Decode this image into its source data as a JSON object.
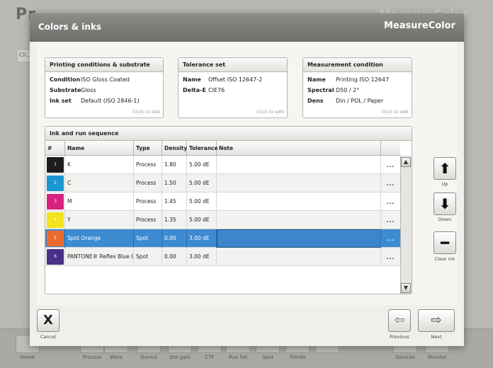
{
  "background": {
    "title": "Pr...",
    "brand": "MeasureColor",
    "sub_label": "Cli...",
    "bottom_tabs": [
      "Home",
      "Process",
      "Worx",
      "Gamut",
      "Dot gain",
      "CTF",
      "Run list",
      "Spot",
      "Trends",
      "",
      "Devices",
      "Monitor"
    ]
  },
  "modal": {
    "title": "Colors & inks",
    "brand": "MeasureColor"
  },
  "printing_conditions": {
    "header": "Printing conditions & substrate",
    "rows": [
      {
        "key": "Condition",
        "value": "ISO Gloss Coated"
      },
      {
        "key": "Substrate",
        "value": "Gloss"
      },
      {
        "key": "Ink set",
        "value": "Default  (ISO 2846-1)"
      }
    ],
    "hint": "Click to edit"
  },
  "tolerance_set": {
    "header": "Tolerance set",
    "rows": [
      {
        "key": "Name",
        "value": "Offset ISO 12647-2"
      },
      {
        "key": "Delta-E",
        "value": "CIE76"
      }
    ],
    "hint": "Click to edit"
  },
  "measurement_condition": {
    "header": "Measurement condition",
    "rows": [
      {
        "key": "Name",
        "value": "Printing ISO 12647"
      },
      {
        "key": "Spectral",
        "value": "D50 / 2°"
      },
      {
        "key": "Dens",
        "value": "Din / POL / Paper"
      }
    ],
    "hint": "Click to edit"
  },
  "ink_table": {
    "caption": "Ink and run sequence",
    "columns": [
      "#",
      "Name",
      "Type",
      "Density",
      "Tolerance",
      "Note"
    ],
    "rows": [
      {
        "num": "1",
        "color": "#1c1c1c",
        "name": "K",
        "type": "Process",
        "density": "1.80",
        "tolerance": "5.00 dE",
        "note": "",
        "more": "..."
      },
      {
        "num": "2",
        "color": "#1a97d3",
        "name": "C",
        "type": "Process",
        "density": "1.50",
        "tolerance": "5.00 dE",
        "note": "",
        "more": "..."
      },
      {
        "num": "3",
        "color": "#d8207e",
        "name": "M",
        "type": "Process",
        "density": "1.45",
        "tolerance": "5.00 dE",
        "note": "",
        "more": "..."
      },
      {
        "num": "4",
        "color": "#f2e31c",
        "name": "Y",
        "type": "Process",
        "density": "1.35",
        "tolerance": "5.00 dE",
        "note": "",
        "more": "..."
      },
      {
        "num": "5",
        "color": "#ec6a2c",
        "name": "Spot Orange",
        "type": "Spot",
        "density": "0.00",
        "tolerance": "3.00 dE",
        "note": "",
        "more": "..."
      },
      {
        "num": "6",
        "color": "#4a2f86",
        "name": "PANTONE® Reflex Blue C",
        "type": "Spot",
        "density": "0.00",
        "tolerance": "3.00 dE",
        "note": "",
        "more": "..."
      }
    ],
    "selected_row": 4
  },
  "side_buttons": {
    "up": "Up",
    "down": "Down",
    "clear": "Clear ink"
  },
  "footer": {
    "cancel": "Cancel",
    "previous": "Previous",
    "next": "Next"
  }
}
